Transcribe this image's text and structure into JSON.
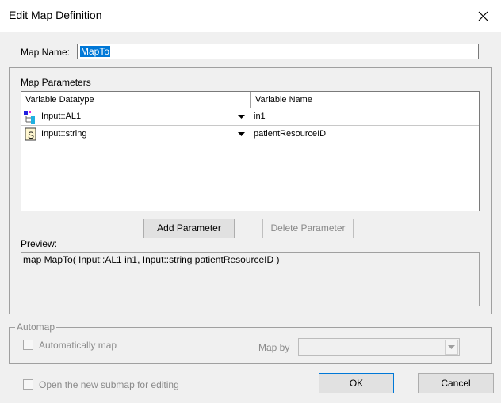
{
  "window": {
    "title": "Edit Map Definition"
  },
  "map_name": {
    "label": "Map Name:",
    "value": "MapTo"
  },
  "parameters": {
    "group_label": "Map Parameters",
    "columns": [
      "Variable Datatype",
      "Variable Name"
    ],
    "rows": [
      {
        "icon": "segment-icon",
        "datatype": "Input::AL1",
        "name": "in1"
      },
      {
        "icon": "string-icon",
        "datatype": "Input::string",
        "name": "patientResourceID"
      }
    ],
    "add_button": "Add Parameter",
    "delete_button": "Delete Parameter"
  },
  "preview": {
    "label": "Preview:",
    "text": "map MapTo( Input::AL1 in1, Input::string  patientResourceID )"
  },
  "automap": {
    "group_label": "Automap",
    "checkbox_label": "Automatically map",
    "checked": false,
    "map_by_label": "Map by",
    "map_by_value": ""
  },
  "footer": {
    "open_submap_label": "Open the new submap for editing",
    "open_submap_checked": false,
    "ok_button": "OK",
    "cancel_button": "Cancel"
  },
  "colors": {
    "selection": "#0078d7",
    "dialog_bg": "#f0f0f0",
    "disabled_text": "#8a8a8a"
  }
}
